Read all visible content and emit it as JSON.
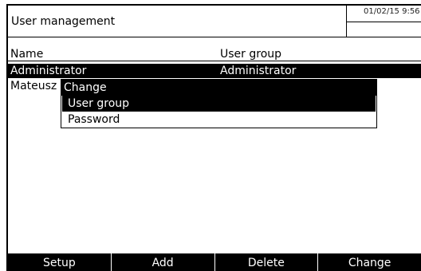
{
  "header": {
    "title": "User management",
    "datetime": "01/02/15 9:56"
  },
  "table": {
    "columns": [
      "Name",
      "User group"
    ],
    "rows": [
      {
        "name": "Administrator",
        "group": "Administrator",
        "selected": true
      },
      {
        "name": "Mateusz",
        "group": "",
        "selected": false
      }
    ]
  },
  "popup": {
    "title": "Change",
    "items": [
      {
        "label": "User group",
        "active": true
      },
      {
        "label": "Password",
        "active": false
      }
    ]
  },
  "footer": {
    "buttons": [
      "Setup",
      "Add",
      "Delete",
      "Change"
    ]
  }
}
